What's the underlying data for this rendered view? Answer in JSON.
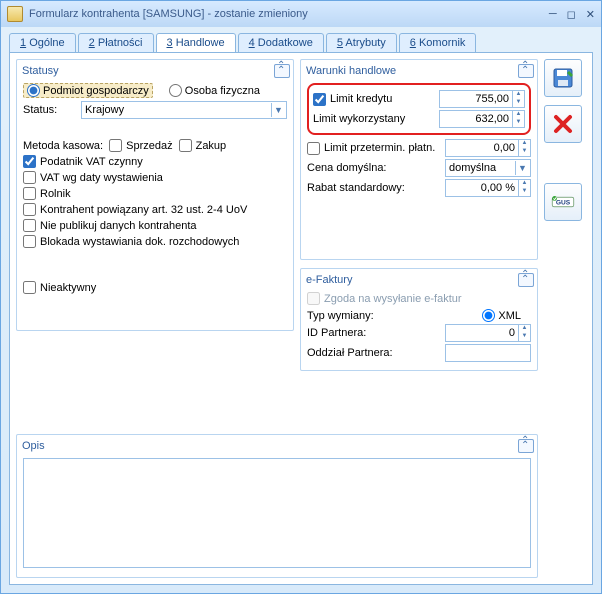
{
  "window": {
    "title": "Formularz kontrahenta [SAMSUNG] - zostanie zmieniony"
  },
  "tabs": [
    {
      "num": "1",
      "label": "Ogólne"
    },
    {
      "num": "2",
      "label": "Płatności"
    },
    {
      "num": "3",
      "label": "Handlowe"
    },
    {
      "num": "4",
      "label": "Dodatkowe"
    },
    {
      "num": "5",
      "label": "Atrybuty"
    },
    {
      "num": "6",
      "label": "Komornik"
    }
  ],
  "statusy": {
    "title": "Statusy",
    "podmiot_gosp": "Podmiot gospodarczy",
    "osoba_fiz": "Osoba fizyczna",
    "status_label": "Status:",
    "status_value": "Krajowy",
    "metoda_label": "Metoda kasowa:",
    "sprzedaz": "Sprzedaż",
    "zakup": "Zakup",
    "checks": {
      "vat_czynny": "Podatnik VAT czynny",
      "vat_data": "VAT wg daty wystawienia",
      "rolnik": "Rolnik",
      "powiazany": "Kontrahent powiązany art. 32 ust. 2-4 UoV",
      "nie_publikuj": "Nie publikuj danych kontrahenta",
      "blokada": "Blokada wystawiania dok. rozchodowych",
      "nieaktywny": "Nieaktywny"
    }
  },
  "warunki": {
    "title": "Warunki handlowe",
    "limit_kredytu": "Limit kredytu",
    "limit_kredytu_val": "755,00",
    "limit_wyk": "Limit wykorzystany",
    "limit_wyk_val": "632,00",
    "limit_przeterm": "Limit przetermin. płatn.",
    "limit_przeterm_val": "0,00",
    "cena_dom": "Cena domyślna:",
    "cena_dom_val": "domyślna",
    "rabat": "Rabat standardowy:",
    "rabat_val": "0,00 %"
  },
  "efaktury": {
    "title": "e-Faktury",
    "zgoda": "Zgoda na wysyłanie e-faktur",
    "typ": "Typ wymiany:",
    "xml": "XML",
    "id_part": "ID Partnera:",
    "id_part_val": "0",
    "oddzial": "Oddział Partnera:",
    "oddzial_val": ""
  },
  "opis": {
    "title": "Opis",
    "value": ""
  },
  "sidebuttons": {
    "save": "save-icon",
    "cancel": "cancel-icon",
    "gus": "GUS"
  }
}
